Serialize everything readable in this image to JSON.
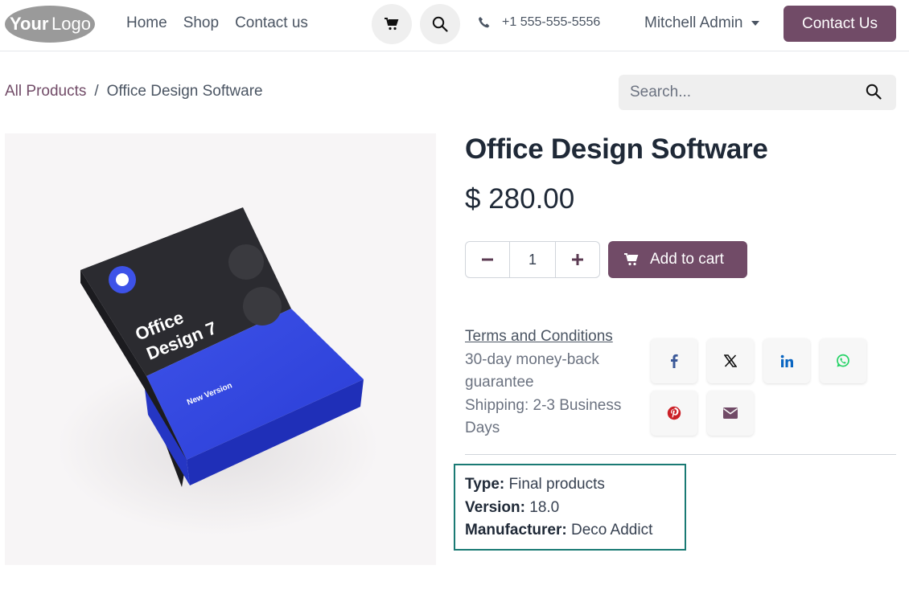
{
  "header": {
    "logo_text": "YourLogo",
    "nav": [
      "Home",
      "Shop",
      "Contact us"
    ],
    "cart_icon": "cart-icon",
    "search_icon": "search-icon",
    "phone": "+1 555-555-5556",
    "user": "Mitchell Admin",
    "contact_button": "Contact Us"
  },
  "breadcrumb": {
    "parent": "All Products",
    "separator": "/",
    "current": "Office Design Software"
  },
  "search": {
    "placeholder": "Search..."
  },
  "product": {
    "title": "Office Design Software",
    "price": "$ 280.00",
    "quantity": "1",
    "add_to_cart": "Add to cart",
    "image": {
      "box_title_line1": "Office",
      "box_title_line2": "Design 7",
      "box_tag": "New Version"
    }
  },
  "terms": {
    "link": "Terms and Conditions",
    "line1": "30-day money-back guarantee",
    "line2": "Shipping: 2-3 Business Days"
  },
  "share": [
    {
      "name": "facebook-icon",
      "color": "#3b5998"
    },
    {
      "name": "x-icon",
      "color": "#111111"
    },
    {
      "name": "linkedin-icon",
      "color": "#0a66c2"
    },
    {
      "name": "whatsapp-icon",
      "color": "#25d366"
    },
    {
      "name": "pinterest-icon",
      "color": "#cb2027"
    },
    {
      "name": "email-icon",
      "color": "#714b67"
    }
  ],
  "attributes": [
    {
      "label": "Type:",
      "value": "Final products"
    },
    {
      "label": "Version:",
      "value": "18.0"
    },
    {
      "label": "Manufacturer:",
      "value": "Deco Addict"
    }
  ],
  "colors": {
    "brand": "#714b67",
    "attr_border": "#1a7a74"
  }
}
